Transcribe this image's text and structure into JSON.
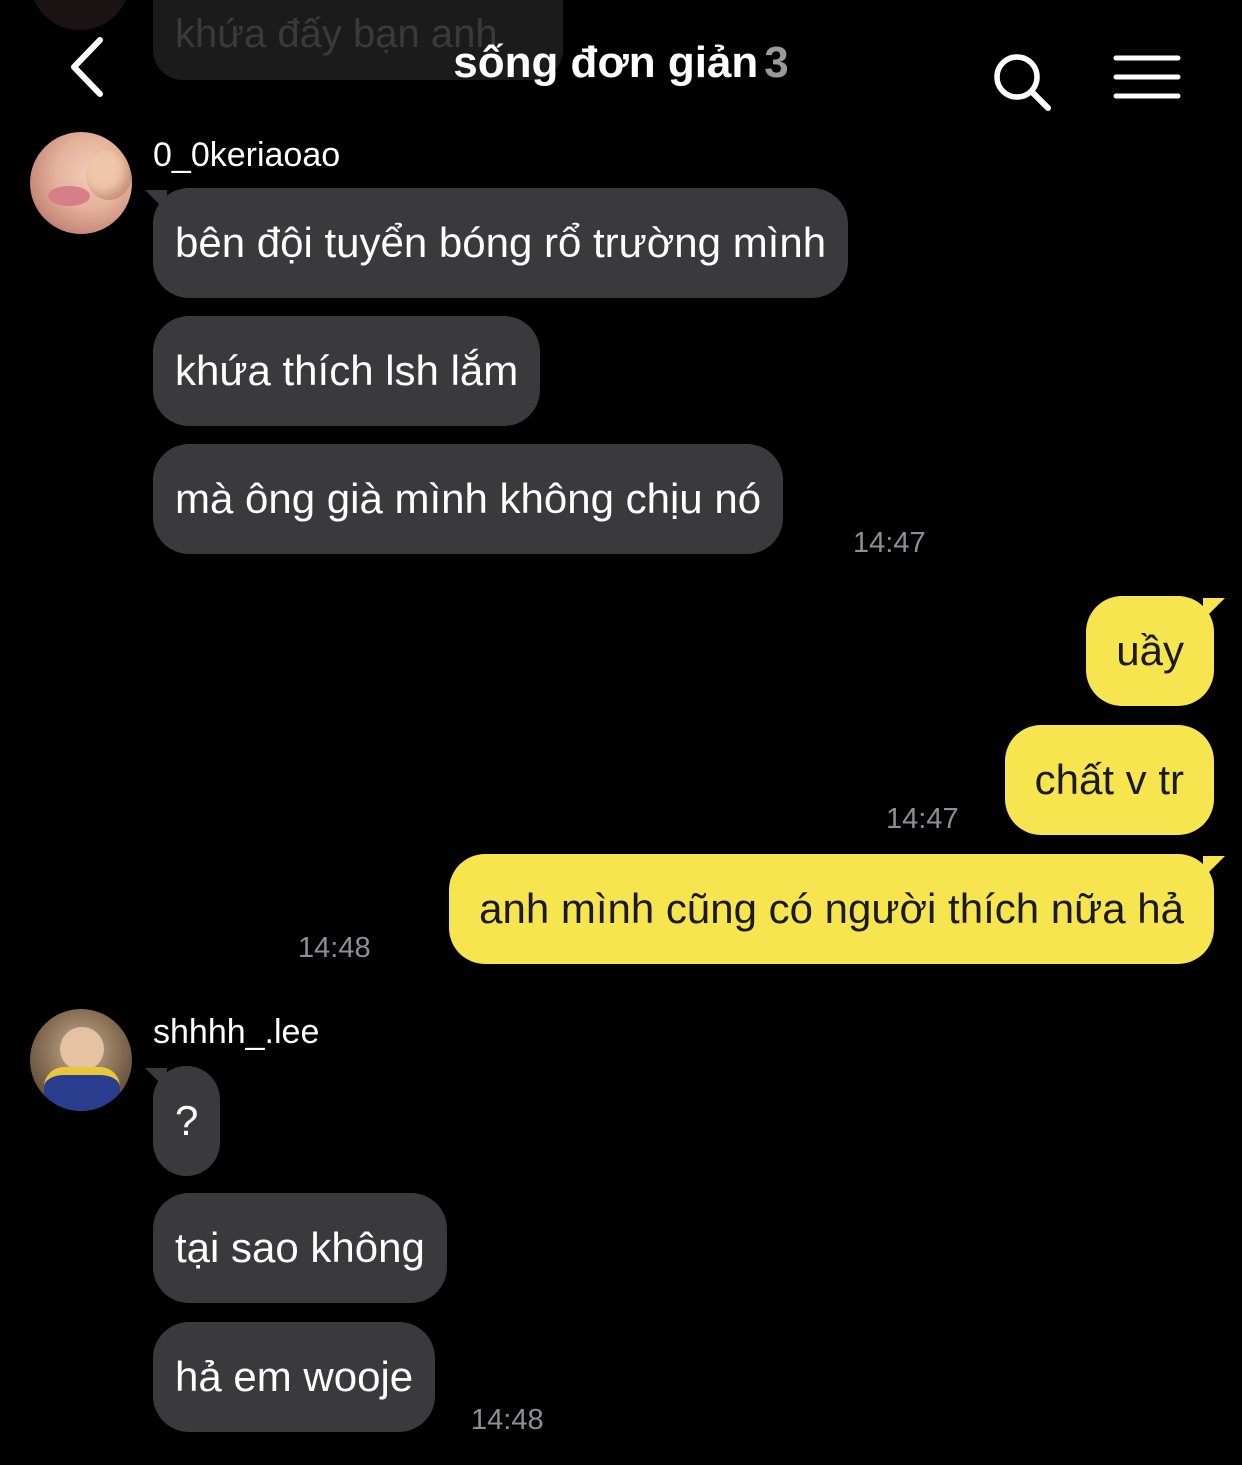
{
  "header": {
    "title": "sống đơn giản",
    "member_count": "3",
    "back_icon": "chevron-left-icon",
    "search_icon": "search-icon",
    "menu_icon": "menu-icon"
  },
  "previous_message": {
    "text": "khứa đấy bạn anh"
  },
  "colors": {
    "background": "#000000",
    "incoming_bubble": "#3a3a3c",
    "outgoing_bubble": "#f7e54f",
    "timestamp": "#8e8e93"
  },
  "groups": [
    {
      "sender": "0_0keriaoao",
      "messages": [
        "bên đội tuyển bóng rổ trường mình",
        "khứa thích lsh lắm",
        "mà ông già mình không chịu nó"
      ],
      "time": "14:47"
    },
    {
      "sender": "me",
      "messages": [
        "uầy",
        "chất v tr"
      ],
      "time": "14:47"
    },
    {
      "sender": "me",
      "messages": [
        "anh mình cũng có người thích nữa hả"
      ],
      "time": "14:48"
    },
    {
      "sender": "shhhh_.lee",
      "messages": [
        "?",
        "tại sao không",
        "hả em wooje"
      ],
      "time": "14:48"
    }
  ]
}
